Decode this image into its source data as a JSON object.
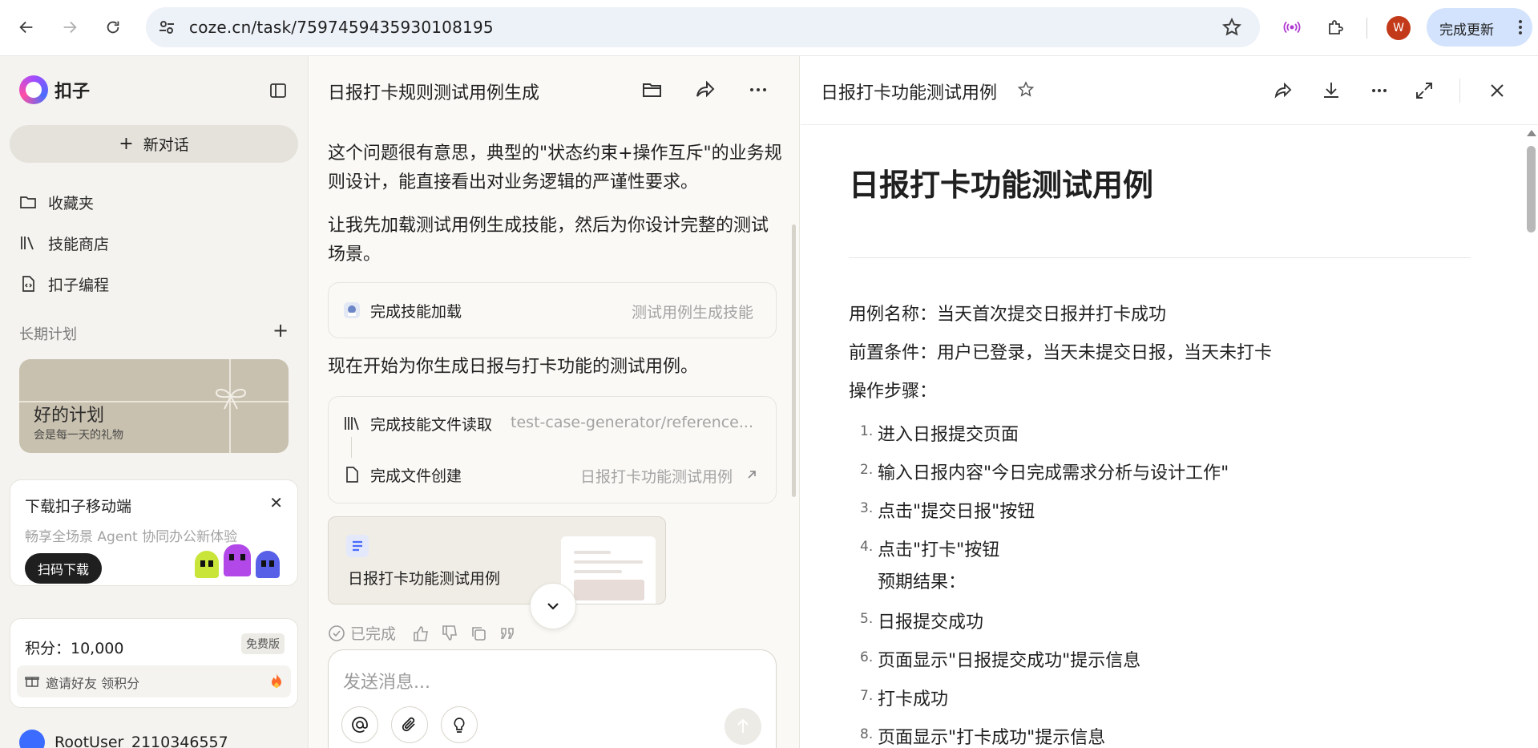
{
  "browser": {
    "url": "coze.cn/task/7597459435930108195",
    "avatar_letter": "W",
    "update_label": "完成更新"
  },
  "sidebar": {
    "app_name": "扣子",
    "new_chat": "新对话",
    "items": [
      {
        "label": "收藏夹",
        "icon": "folder-icon"
      },
      {
        "label": "技能商店",
        "icon": "library-icon"
      },
      {
        "label": "扣子编程",
        "icon": "code-file-icon"
      }
    ],
    "section_label": "长期计划",
    "plan_card": {
      "title": "好的计划",
      "subtitle": "会是每一天的礼物"
    },
    "download_card": {
      "title": "下载扣子移动端",
      "subtitle": "畅享全场景 Agent 协同办公新体验",
      "button": "扫码下载"
    },
    "points": {
      "label": "积分：10,000",
      "badge": "免费版",
      "invite": "邀请好友 领积分"
    },
    "user_name": "RootUser_2110346557"
  },
  "chat": {
    "title": "日报打卡规则测试用例生成",
    "messages": [
      "这个问题很有意思，典型的\"状态约束+操作互斥\"的业务规则设计，能直接看出对业务逻辑的严谨性要求。",
      "让我先加载测试用例生成技能，然后为你设计完整的测试场景。",
      "现在开始为你生成日报与打卡功能的测试用例。"
    ],
    "tool_skill": {
      "label": "完成技能加载",
      "detail": "测试用例生成技能"
    },
    "tool_read": {
      "label": "完成技能文件读取",
      "detail": "test-case-generator/reference..."
    },
    "tool_create": {
      "label": "完成文件创建",
      "detail": "日报打卡功能测试用例"
    },
    "file_card_name": "日报打卡功能测试用例",
    "status": "已完成",
    "composer_placeholder": "发送消息..."
  },
  "document": {
    "header_title": "日报打卡功能测试用例",
    "h1": "日报打卡功能测试用例",
    "case_name": "用例名称：当天首次提交日报并打卡成功",
    "precondition": "前置条件：用户已登录，当天未提交日报，当天未打卡",
    "steps_label": "操作步骤：",
    "list": [
      {
        "num": "1.",
        "text": "进入日报提交页面"
      },
      {
        "num": "2.",
        "text": "输入日报内容\"今日完成需求分析与设计工作\""
      },
      {
        "num": "3.",
        "text": "点击\"提交日报\"按钮"
      },
      {
        "num": "4.",
        "text": "点击\"打卡\"按钮",
        "sub": "预期结果："
      },
      {
        "num": "5.",
        "text": "日报提交成功"
      },
      {
        "num": "6.",
        "text": "页面显示\"日报提交成功\"提示信息"
      },
      {
        "num": "7.",
        "text": "打卡成功"
      },
      {
        "num": "8.",
        "text": "页面显示\"打卡成功\"提示信息"
      }
    ]
  }
}
